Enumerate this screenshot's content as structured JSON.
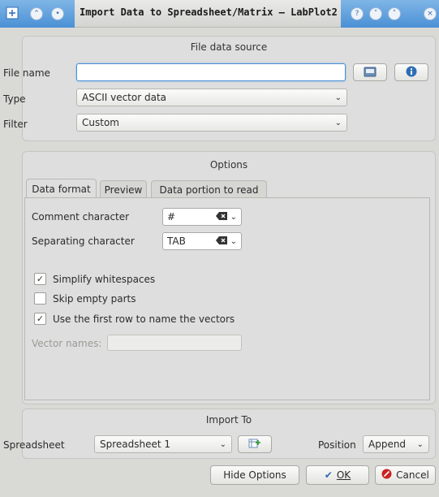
{
  "window": {
    "title": "Import Data to Spreadsheet/Matrix – LabPlot2"
  },
  "file_source": {
    "section_title": "File data source",
    "file_name_label": "File name",
    "file_name_value": "",
    "type_label": "Type",
    "type_value": "ASCII vector data",
    "filter_label": "Filter",
    "filter_value": "Custom"
  },
  "options": {
    "section_title": "Options",
    "tabs": [
      {
        "label": "Data format",
        "active": true
      },
      {
        "label": "Preview",
        "active": false
      },
      {
        "label": "Data portion to read",
        "active": false
      }
    ],
    "comment_label": "Comment character",
    "comment_value": "#",
    "separator_label": "Separating character",
    "separator_value": "TAB",
    "checks": [
      {
        "label": "Simplify whitespaces",
        "checked": true
      },
      {
        "label": "Skip empty parts",
        "checked": false
      },
      {
        "label": "Use the first row to name the vectors",
        "checked": true
      }
    ],
    "vector_names_label": "Vector names:",
    "vector_names_value": ""
  },
  "import_to": {
    "section_title": "Import To",
    "spreadsheet_label": "Spreadsheet",
    "spreadsheet_value": "Spreadsheet 1",
    "position_label": "Position",
    "position_value": "Append"
  },
  "buttons": {
    "hide_options": "Hide Options",
    "ok": "OK",
    "cancel": "Cancel"
  },
  "colors": {
    "accent": "#4a90d6",
    "panel": "#dedede",
    "cancel_icon": "#cc2222"
  }
}
